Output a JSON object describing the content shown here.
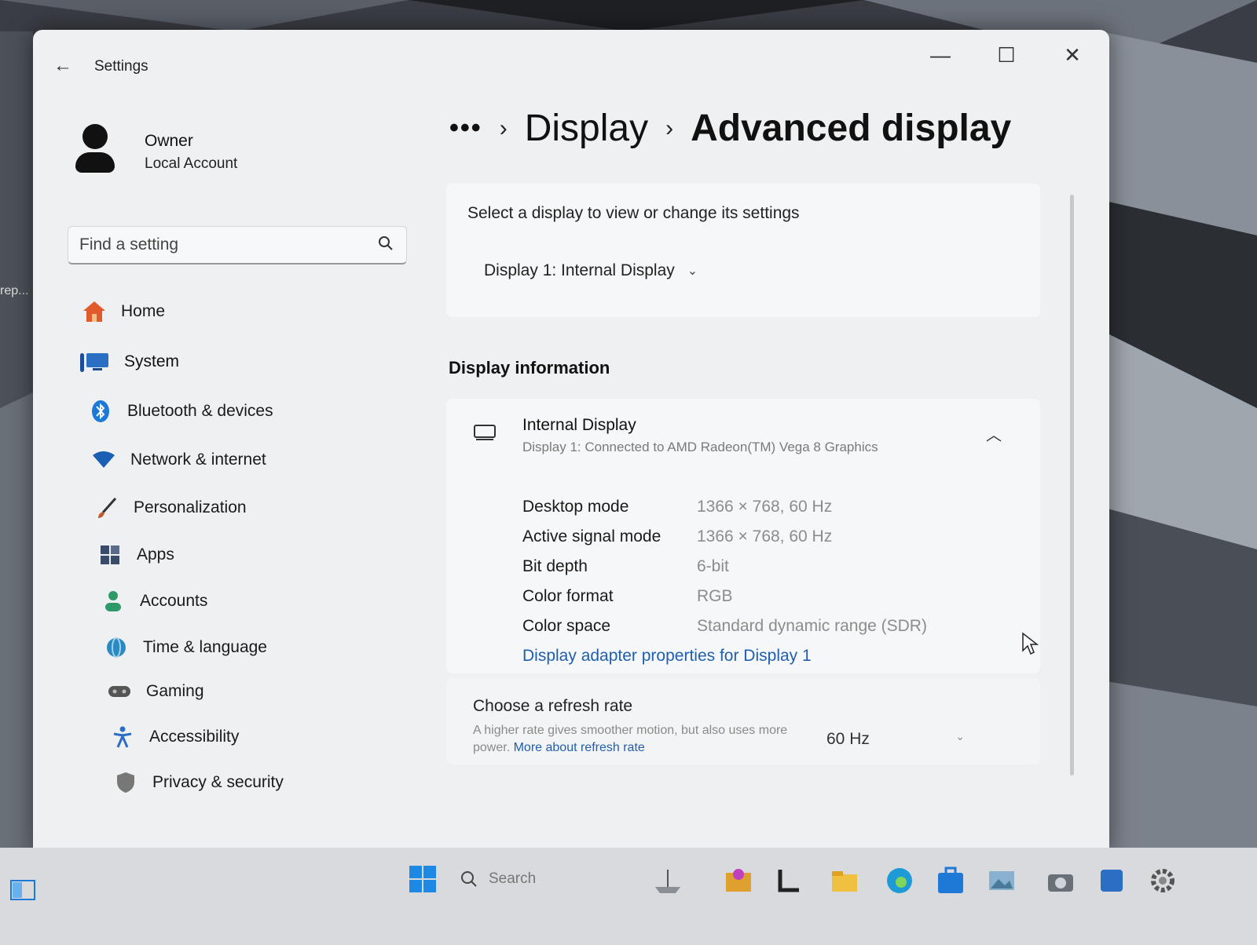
{
  "window": {
    "app_title": "Settings",
    "controls": {
      "minimize": "—",
      "maximize": "☐",
      "close": "✕"
    }
  },
  "profile": {
    "name": "Owner",
    "account": "Local Account"
  },
  "search": {
    "placeholder": "Find a setting"
  },
  "nav": {
    "items": [
      {
        "label": "Home",
        "icon": "home-icon",
        "color": "#e05a2b"
      },
      {
        "label": "System",
        "icon": "system-icon",
        "color": "#2a6fc4"
      },
      {
        "label": "Bluetooth & devices",
        "icon": "bluetooth-icon",
        "color": "#1e78d6"
      },
      {
        "label": "Network & internet",
        "icon": "wifi-icon",
        "color": "#1a5fb4"
      },
      {
        "label": "Personalization",
        "icon": "brush-icon",
        "color": "#c05a2a"
      },
      {
        "label": "Apps",
        "icon": "apps-icon",
        "color": "#3a4a6a"
      },
      {
        "label": "Accounts",
        "icon": "accounts-icon",
        "color": "#2e9a6a"
      },
      {
        "label": "Time & language",
        "icon": "globe-icon",
        "color": "#2a8ac0"
      },
      {
        "label": "Gaming",
        "icon": "controller-icon",
        "color": "#555"
      },
      {
        "label": "Accessibility",
        "icon": "accessibility-icon",
        "color": "#2a6fc4"
      },
      {
        "label": "Privacy & security",
        "icon": "shield-icon",
        "color": "#666"
      }
    ],
    "selected": "System"
  },
  "breadcrumb": {
    "more": "•••",
    "parent": "Display",
    "current": "Advanced display",
    "sep": "›"
  },
  "select_display": {
    "label": "Select a display to view or change its settings",
    "value": "Display 1: Internal Display"
  },
  "display_info": {
    "section_title": "Display information",
    "name": "Internal Display",
    "subtitle": "Display 1: Connected to AMD Radeon(TM) Vega 8 Graphics",
    "rows": [
      {
        "key": "Desktop mode",
        "value": "1366 × 768, 60 Hz"
      },
      {
        "key": "Active signal mode",
        "value": "1366 × 768, 60 Hz"
      },
      {
        "key": "Bit depth",
        "value": "6-bit"
      },
      {
        "key": "Color format",
        "value": "RGB"
      },
      {
        "key": "Color space",
        "value": "Standard dynamic range (SDR)"
      }
    ],
    "adapter_link": "Display adapter properties for Display 1"
  },
  "refresh_rate": {
    "title": "Choose a refresh rate",
    "desc": "A higher rate gives smoother motion, but also uses more power.",
    "link": "More about refresh rate",
    "value": "60 Hz"
  },
  "desktop": {
    "icon_label": "rep..."
  },
  "taskbar": {
    "search_placeholder": "Search"
  },
  "colors": {
    "accent": "#1b4d9b",
    "link": "#1f5fb0"
  }
}
